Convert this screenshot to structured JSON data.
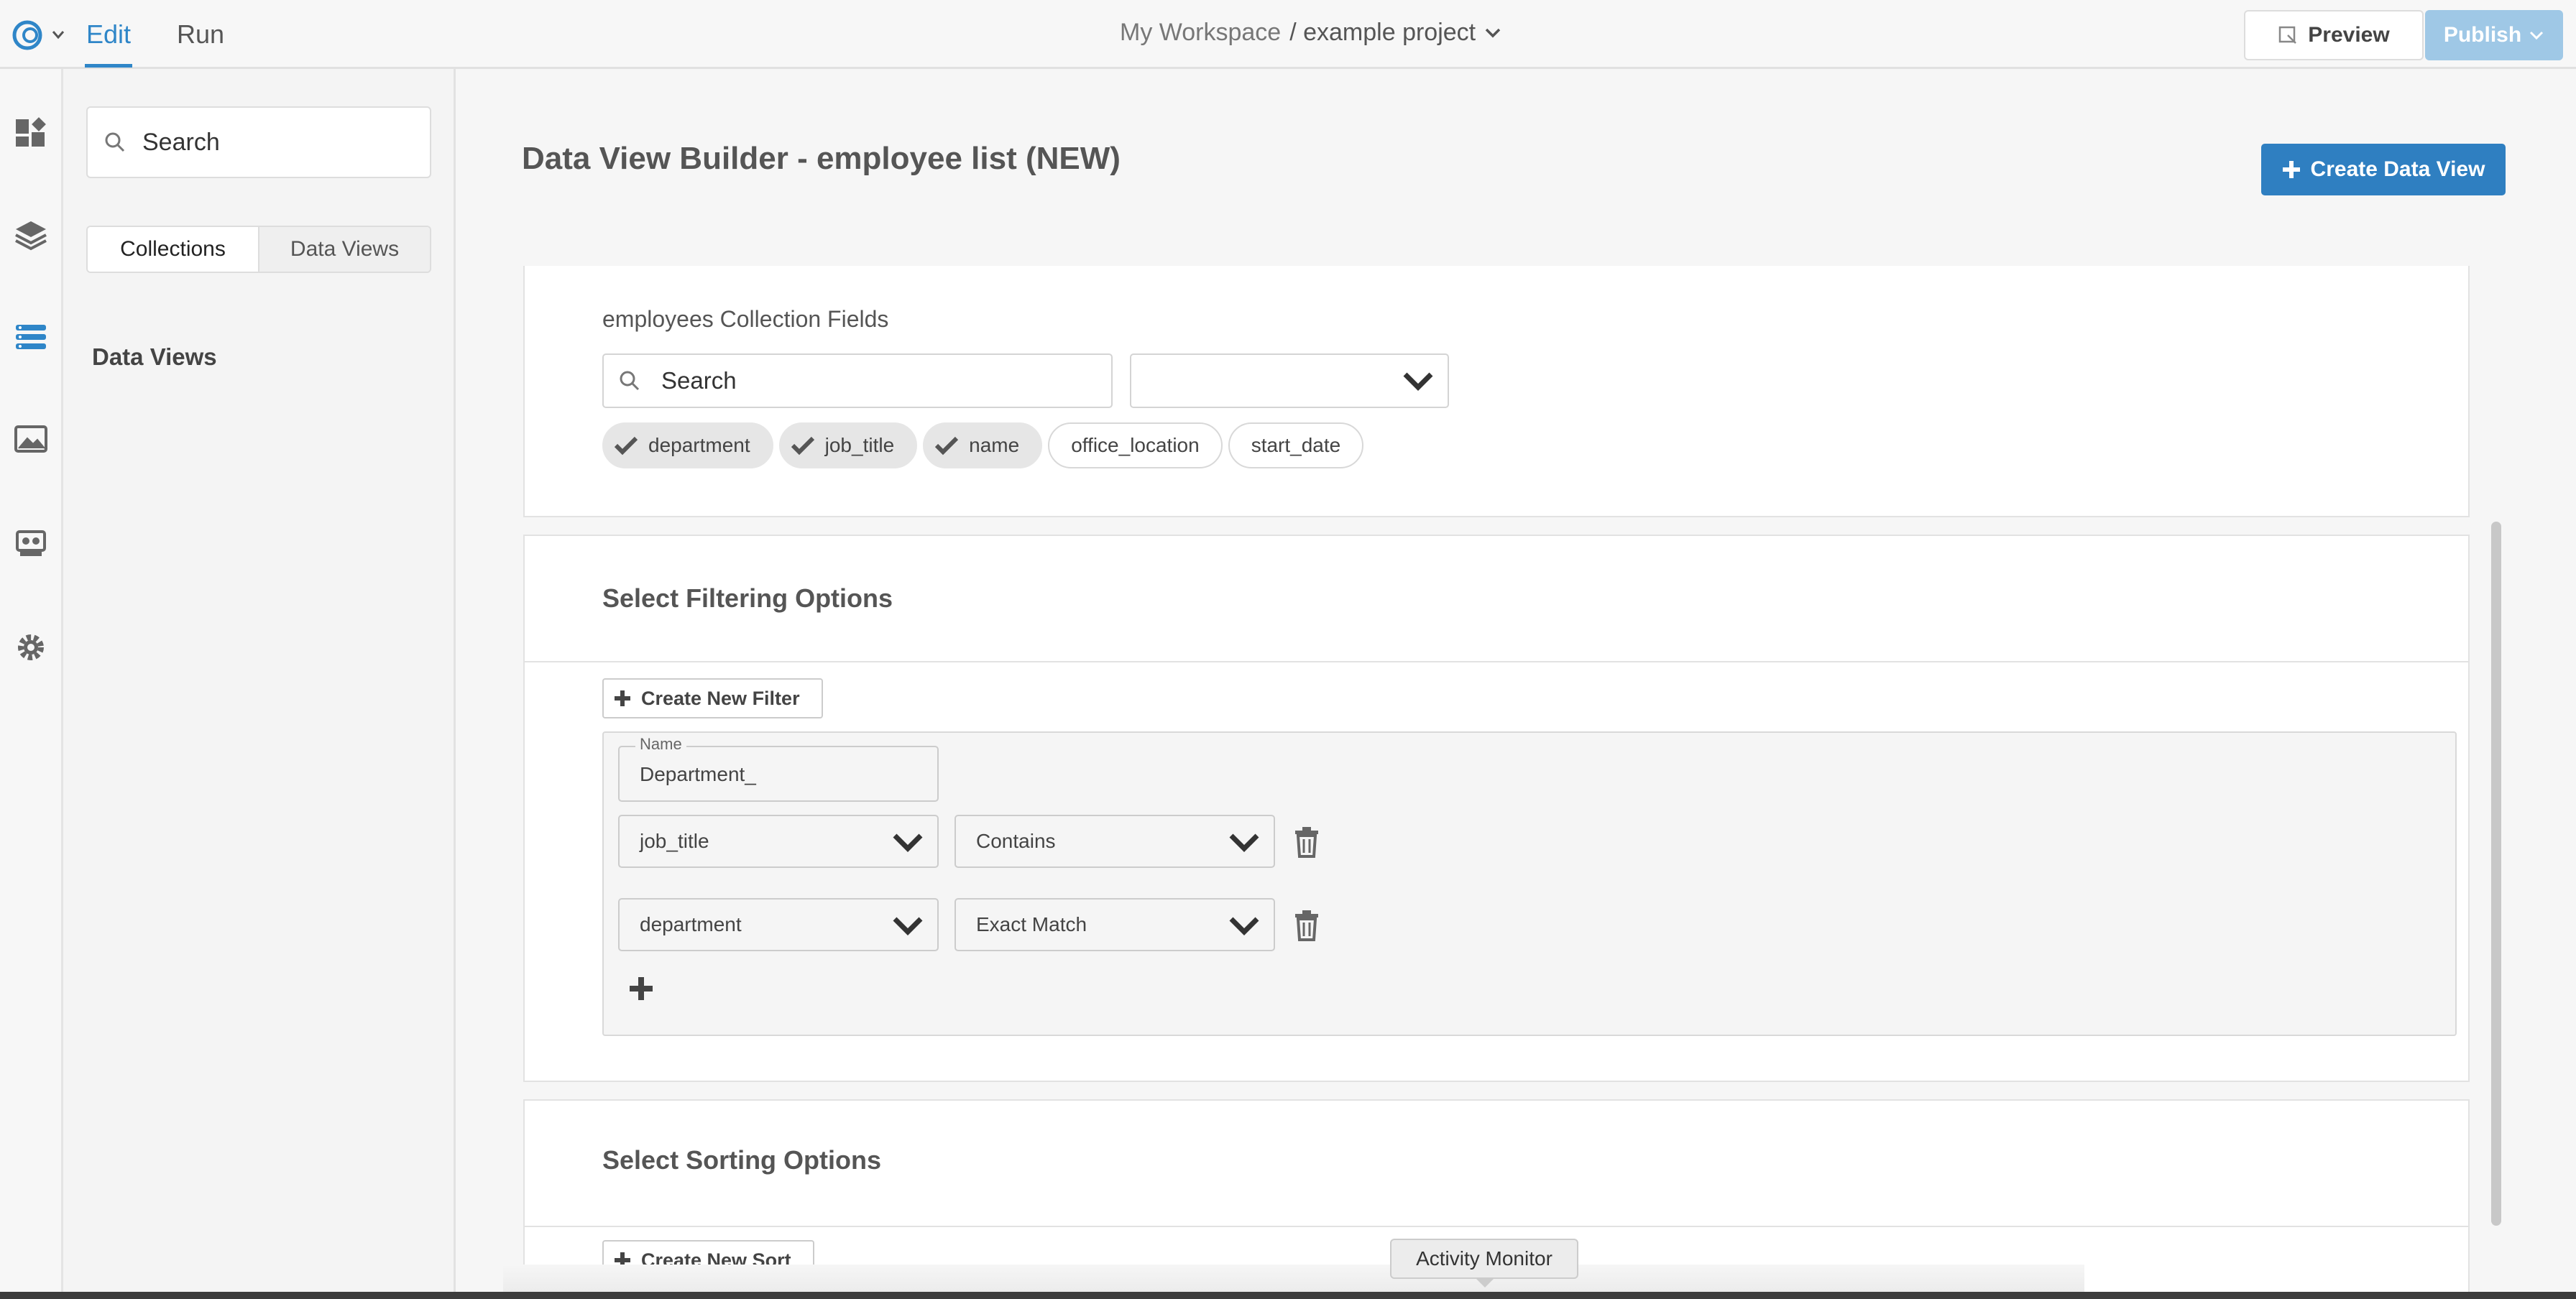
{
  "topbar": {
    "modes": {
      "edit": "Edit",
      "run": "Run"
    },
    "workspace": "My Workspace",
    "project": "/ example project",
    "preview_label": "Preview",
    "publish_label": "Publish"
  },
  "rail": {
    "icons": [
      "dashboard-icon",
      "layers-icon",
      "list-icon",
      "image-icon",
      "integrations-icon",
      "gear-icon"
    ],
    "active": "list-icon",
    "active_color": "#2f86c8"
  },
  "sidepanel": {
    "search_placeholder": "Search",
    "tabs": [
      "Collections",
      "Data Views"
    ],
    "active_tab": "Collections",
    "heading": "Data Views"
  },
  "main": {
    "title": "Data View Builder - employee list (NEW)",
    "create_button": "Create Data View",
    "fields": {
      "label": "employees Collection Fields",
      "search_placeholder": "Search",
      "chips": [
        {
          "label": "department",
          "selected": true
        },
        {
          "label": "job_title",
          "selected": true
        },
        {
          "label": "name",
          "selected": true
        },
        {
          "label": "office_location",
          "selected": false
        },
        {
          "label": "start_date",
          "selected": false
        }
      ]
    },
    "filtering": {
      "title": "Select Filtering Options",
      "create_button": "Create New Filter",
      "filter": {
        "name_legend": "Name",
        "name_value": "Department_",
        "conditions": [
          {
            "field": "job_title",
            "operator": "Contains"
          },
          {
            "field": "department",
            "operator": "Exact Match"
          }
        ]
      }
    },
    "sorting": {
      "title": "Select Sorting Options",
      "create_button": "Create New Sort"
    }
  },
  "tooltip": "Activity Monitor",
  "colors": {
    "accent": "#2f7fc1",
    "publish_disabled": "#9fc8e6"
  }
}
